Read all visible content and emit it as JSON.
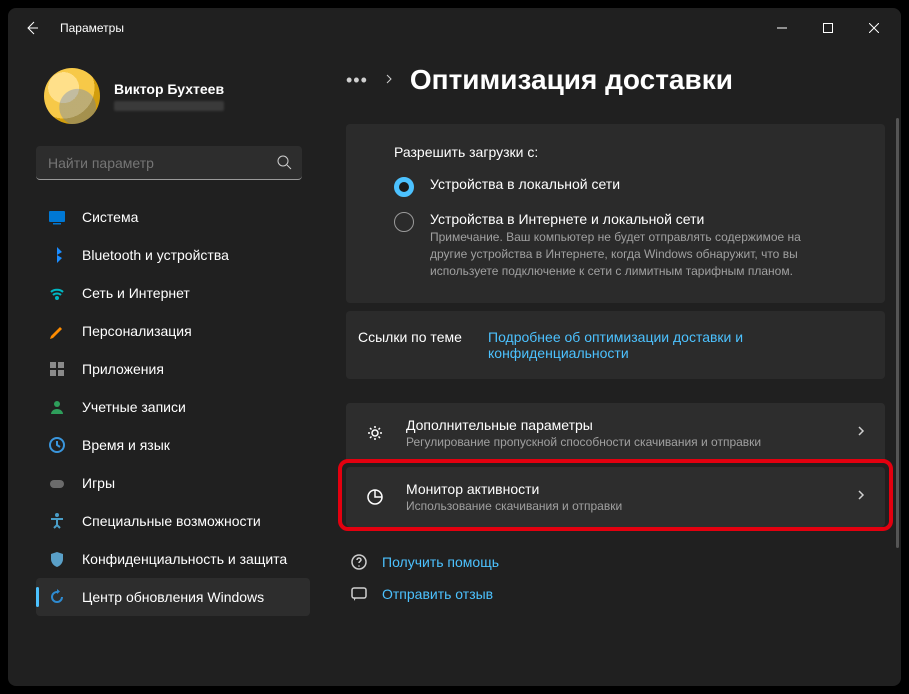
{
  "titlebar": {
    "app_title": "Параметры"
  },
  "profile": {
    "name": "Виктор Бухтеев"
  },
  "search": {
    "placeholder": "Найти параметр"
  },
  "nav": {
    "items": [
      {
        "label": "Система",
        "icon": "system",
        "color": "#0078d4"
      },
      {
        "label": "Bluetooth и устройства",
        "icon": "bluetooth",
        "color": "#1a8cff"
      },
      {
        "label": "Сеть и Интернет",
        "icon": "wifi",
        "color": "#00b7c3"
      },
      {
        "label": "Персонализация",
        "icon": "paint",
        "color": "#ff8c00"
      },
      {
        "label": "Приложения",
        "icon": "apps",
        "color": "#8a8a8a"
      },
      {
        "label": "Учетные записи",
        "icon": "user",
        "color": "#2e9e5b"
      },
      {
        "label": "Время и язык",
        "icon": "clock",
        "color": "#3a96dd"
      },
      {
        "label": "Игры",
        "icon": "gamepad",
        "color": "#6b6b6b"
      },
      {
        "label": "Специальные возможности",
        "icon": "accessibility",
        "color": "#4a9ec8"
      },
      {
        "label": "Конфиденциальность и защита",
        "icon": "shield",
        "color": "#5aa0c8"
      },
      {
        "label": "Центр обновления Windows",
        "icon": "update",
        "color": "#2e8bd1"
      }
    ],
    "active_index": 10
  },
  "breadcrumb": {
    "page_title": "Оптимизация доставки"
  },
  "panel": {
    "label": "Разрешить загрузки с:",
    "options": [
      {
        "label": "Устройства в локальной сети",
        "checked": true
      },
      {
        "label": "Устройства в Интернете и локальной сети",
        "checked": false,
        "note": "Примечание. Ваш компьютер не будет отправлять содержимое на другие устройства в Интернете, когда Windows обнаружит, что вы используете подключение к сети с лимитным тарифным планом."
      }
    ]
  },
  "links_row": {
    "label": "Ссылки по теме",
    "link": "Подробнее об оптимизации доставки и конфиденциальности"
  },
  "cards": [
    {
      "title": "Дополнительные параметры",
      "sub": "Регулирование пропускной способности скачивания и отправки",
      "icon": "gear"
    },
    {
      "title": "Монитор активности",
      "sub": "Использование скачивания и отправки",
      "icon": "chart",
      "highlighted": true
    }
  ],
  "foot": [
    {
      "label": "Получить помощь",
      "icon": "help"
    },
    {
      "label": "Отправить отзыв",
      "icon": "feedback"
    }
  ]
}
